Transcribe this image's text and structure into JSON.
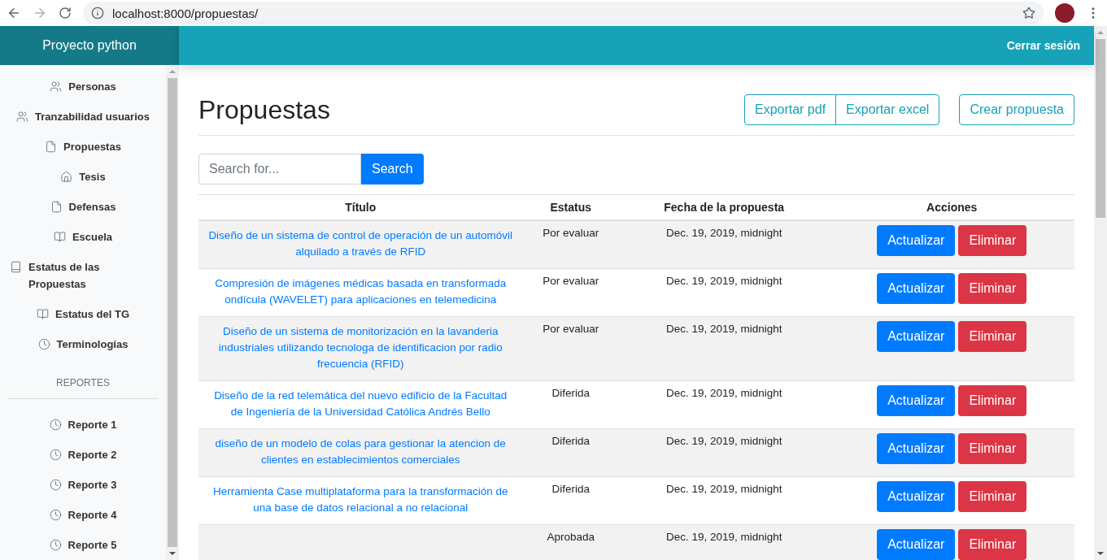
{
  "browser": {
    "url": "localhost:8000/propuestas/"
  },
  "navbar": {
    "brand": "Proyecto python",
    "logout": "Cerrar sesión"
  },
  "sidebar": {
    "items": [
      {
        "label": "Personas",
        "kind": "people"
      },
      {
        "label": "Tranzabilidad usuarios",
        "kind": "people"
      },
      {
        "label": "Propuestas",
        "kind": "document"
      },
      {
        "label": "Tesis",
        "kind": "house"
      },
      {
        "label": "Defensas",
        "kind": "document"
      },
      {
        "label": "Escuela",
        "kind": "openbook"
      },
      {
        "label": "Estatus de las Propuestas",
        "kind": "book"
      },
      {
        "label": "Estatus del TG",
        "kind": "openbook"
      },
      {
        "label": "Terminologías",
        "kind": "clock"
      }
    ],
    "section": "REPORTES",
    "reports": [
      {
        "label": "Reporte 1",
        "kind": "clock"
      },
      {
        "label": "Reporte 2",
        "kind": "clock"
      },
      {
        "label": "Reporte 3",
        "kind": "clock"
      },
      {
        "label": "Reporte 4",
        "kind": "clock"
      },
      {
        "label": "Reporte 5",
        "kind": "clock"
      }
    ]
  },
  "page": {
    "title": "Propuestas",
    "export_buttons": [
      "Exportar pdf",
      "Exportar excel"
    ],
    "create_button": "Crear propuesta"
  },
  "search": {
    "placeholder": "Search for...",
    "button": "Search"
  },
  "table": {
    "columns": [
      "Título",
      "Estatus",
      "Fecha de la propuesta",
      "Acciones"
    ],
    "rows": [
      {
        "title": "Diseño de un sistema de control de operación de un automóvil alquilado a través de RFID",
        "status": "Por evaluar",
        "date": "Dec. 19, 2019, midnight",
        "actions": [
          "Actualizar",
          "Eliminar"
        ]
      },
      {
        "title": "Compresión de imágenes médicas basada en transformada ondícula (WAVELET) para aplicaciones en telemedicina",
        "status": "Por evaluar",
        "date": "Dec. 19, 2019, midnight",
        "actions": [
          "Actualizar",
          "Eliminar"
        ]
      },
      {
        "title": "Diseño de un sistema de monitorización en la lavanderia industriales utilizando tecnologa de identificacion por radio frecuencia (RFID)",
        "status": "Por evaluar",
        "date": "Dec. 19, 2019, midnight",
        "actions": [
          "Actualizar",
          "Eliminar"
        ]
      },
      {
        "title": "Diseño de la red telemática del nuevo edificio de la Facultad de Ingeniería de la Universidad Católica Andrés Bello",
        "status": "Diferida",
        "date": "Dec. 19, 2019, midnight",
        "actions": [
          "Actualizar",
          "Eliminar"
        ]
      },
      {
        "title": "diseño de un modelo de colas para gestionar la atencion de clientes en establecimientos comerciales",
        "status": "Diferida",
        "date": "Dec. 19, 2019, midnight",
        "actions": [
          "Actualizar",
          "Eliminar"
        ]
      },
      {
        "title": "Herramienta Case multiplataforma para la transformación de una base de datos relacional a no relacional",
        "status": "Diferida",
        "date": "Dec. 19, 2019, midnight",
        "actions": [
          "Actualizar",
          "Eliminar"
        ]
      },
      {
        "status": "Aprobada",
        "date": "Dec. 19, 2019, midnight",
        "actions": [
          "Actualizar",
          "Eliminar"
        ]
      }
    ]
  }
}
